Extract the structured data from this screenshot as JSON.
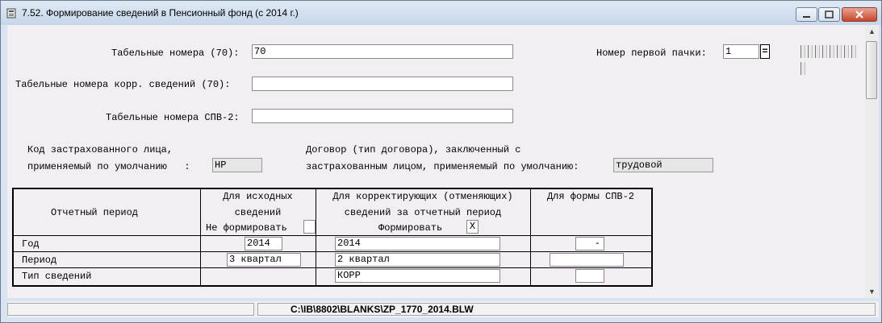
{
  "window": {
    "title": "7.52. Формирование сведений в Пенсионный фонд (с 2014 г.)"
  },
  "form": {
    "tab_numbers_label": "Табельные номера (70):",
    "tab_numbers_value": "70",
    "tab_numbers_corr_label": "Табельные номера корр. сведений (70):",
    "tab_numbers_corr_value": "",
    "tab_numbers_spv2_label": "Табельные номера СПВ-2:",
    "tab_numbers_spv2_value": "",
    "first_pack_label": "Номер первой пачки:",
    "first_pack_value": "1",
    "first_pack_button": "=",
    "insured_code_line1": "Код застрахованного лица,",
    "insured_code_line2": "применяемый по умолчанию   :",
    "insured_code_value": "НР",
    "contract_line1": "Договор (тип договора), заключенный с",
    "contract_line2": "застрахованным лицом, применяемый по умолчанию:",
    "contract_value": "трудовой"
  },
  "table": {
    "col1_header": "Отчетный период",
    "col2_header_l1": "Для исходных",
    "col2_header_l2": "сведений",
    "col2_header_l3": "Не формировать",
    "col3_header_l1": "Для корректирующих (отменяющих)",
    "col3_header_l2": "сведений за отчетный период",
    "col3_header_l3": "Формировать",
    "col3_checkbox": "X",
    "col4_header": "Для формы СПВ-2",
    "rows": [
      {
        "label": "Год",
        "orig": "2014",
        "corr": "2014",
        "spv": "-"
      },
      {
        "label": "Период",
        "orig": "3 квартал",
        "corr": "2 квартал",
        "spv": ""
      },
      {
        "label": "Тип сведений",
        "orig": "",
        "corr": "КОРР",
        "spv": ""
      }
    ]
  },
  "status": {
    "path": "C:\\IB\\8802\\BLANKS\\ZP_1770_2014.BLW"
  }
}
